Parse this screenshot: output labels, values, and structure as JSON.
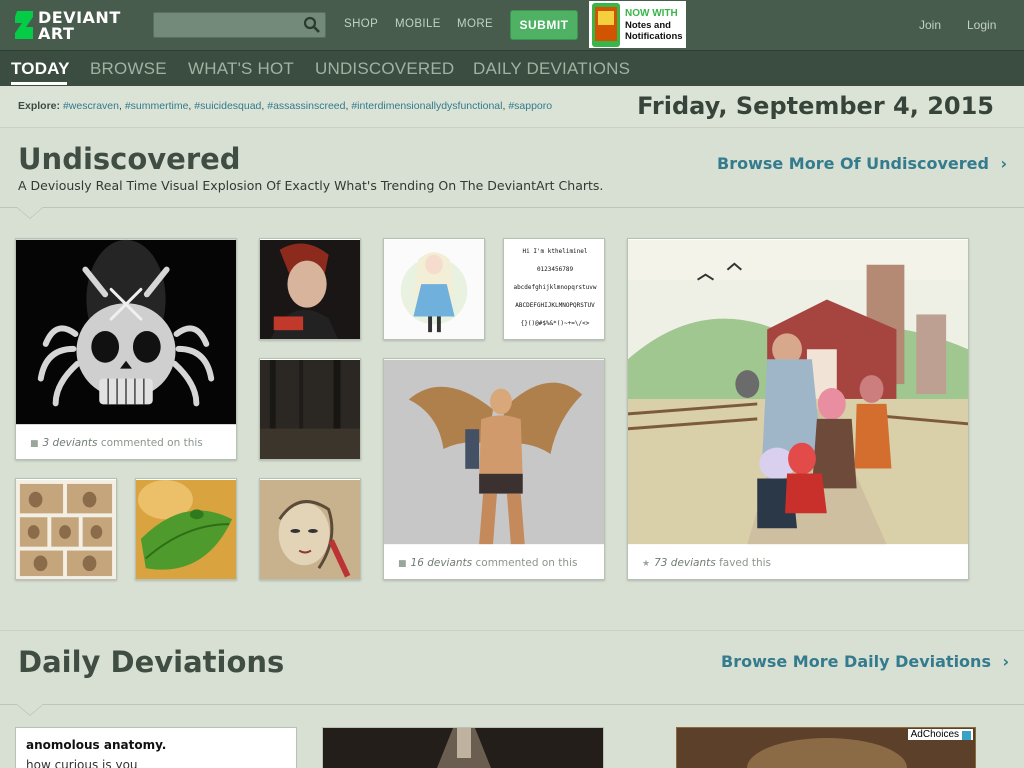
{
  "brand": {
    "line1": "DEVIANT",
    "line2": "ART",
    "accent": "#05cc47"
  },
  "search": {
    "placeholder": ""
  },
  "topnav": {
    "shop": "SHOP",
    "mobile": "MOBILE",
    "more": "MORE",
    "submit": "SUBMIT",
    "join": "Join",
    "login": "Login"
  },
  "phone_ad": {
    "line1": "NOW WITH",
    "line2": "Notes and",
    "line3": "Notifications"
  },
  "tabs": [
    {
      "label": "TODAY",
      "active": true
    },
    {
      "label": "BROWSE"
    },
    {
      "label": "WHAT'S HOT"
    },
    {
      "label": "UNDISCOVERED"
    },
    {
      "label": "DAILY DEVIATIONS"
    }
  ],
  "explore": {
    "label": "Explore:",
    "tags": [
      "#wescraven",
      "#summertime",
      "#suicidesquad",
      "#assassinscreed",
      "#interdimensionallydysfunctional",
      "#sapporo"
    ]
  },
  "date": "Friday, September 4, 2015",
  "undiscovered": {
    "title": "Undiscovered",
    "subtitle": "A Deviously Real Time Visual Explosion Of Exactly What's Trending On The DeviantArt Charts.",
    "browse_link": "Browse More Of Undiscovered",
    "items": [
      {
        "kind": "skull",
        "count": "3 deviants",
        "action": "commented on this"
      },
      {
        "kind": "portrait-red"
      },
      {
        "kind": "dark-forest"
      },
      {
        "kind": "anime-girl-blue"
      },
      {
        "kind": "font-sample",
        "lines": [
          "Hi I'm ktheliminel",
          "0123456789",
          "abcdefghijklmnopqrstuvw",
          "ABCDEFGHIJKLMNOPQRSTUV",
          "{}()@#$%&*()~+=\\/<>"
        ]
      },
      {
        "kind": "winged-warrior",
        "count": "16 deviants",
        "action": "commented on this"
      },
      {
        "kind": "farm-scene",
        "count": "73 deviants",
        "action": "faved this"
      },
      {
        "kind": "comic-page"
      },
      {
        "kind": "frog-leaf"
      },
      {
        "kind": "sketch-drawing"
      }
    ]
  },
  "daily": {
    "title": "Daily Deviations",
    "browse_link": "Browse More Daily Deviations",
    "card1_title": "anomolous anatomy.",
    "card1_text": "how curious is you",
    "adchoices": "AdChoices"
  }
}
